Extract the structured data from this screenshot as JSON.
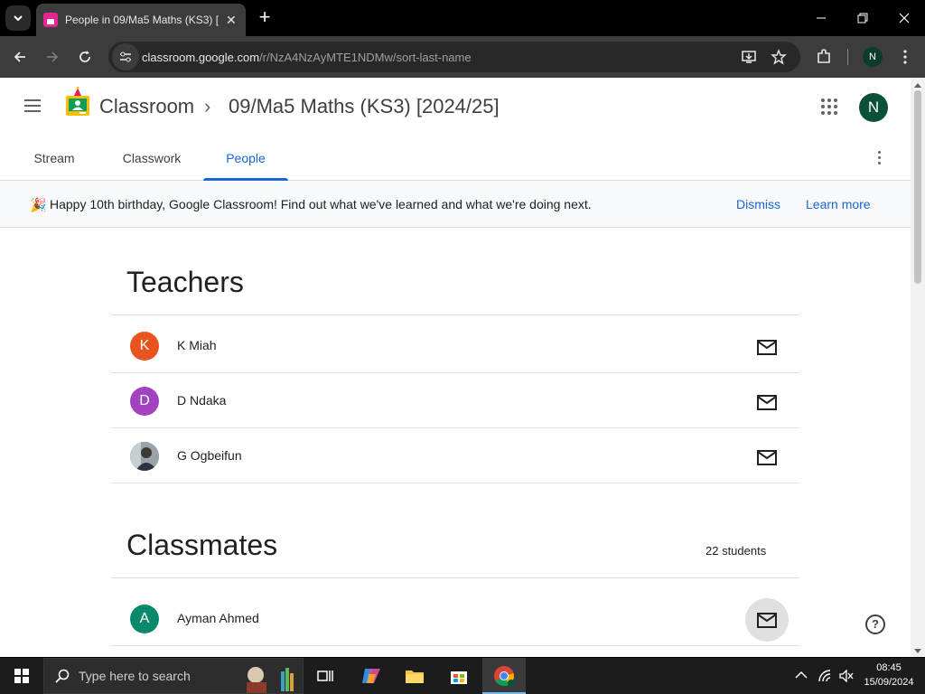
{
  "browser": {
    "tab_title": "People in 09/Ma5 Maths (KS3) [",
    "url_host": "classroom.google.com",
    "url_path": "/r/NzA4NzAyMTE1NDMw/sort-last-name",
    "profile_initial": "N"
  },
  "app": {
    "brand": "Classroom",
    "breadcrumb_sep": "›",
    "class_name": "09/Ma5 Maths (KS3) [2024/25]",
    "avatar_initial": "N"
  },
  "tabs": [
    {
      "label": "Stream"
    },
    {
      "label": "Classwork"
    },
    {
      "label": "People",
      "active": true
    }
  ],
  "banner": {
    "icon": "🎉",
    "message": "Happy 10th birthday, Google Classroom! Find out what we've learned and what we're doing next.",
    "dismiss": "Dismiss",
    "learn_more": "Learn more"
  },
  "teachers": {
    "title": "Teachers",
    "people": [
      {
        "initial": "K",
        "name": "K Miah",
        "color": "#e8541e"
      },
      {
        "initial": "D",
        "name": "D Ndaka",
        "color": "#a142c0"
      },
      {
        "initial": "",
        "name": "G Ogbeifun",
        "color": "#5f6b73"
      }
    ]
  },
  "classmates": {
    "title": "Classmates",
    "count": "22 students",
    "people": [
      {
        "initial": "A",
        "name": "Ayman Ahmed",
        "color": "#0b8a6a"
      }
    ]
  },
  "help": "?",
  "taskbar": {
    "search_placeholder": "Type here to search",
    "time": "08:45",
    "date": "15/09/2024"
  },
  "colors": {
    "accent": "#1967d2",
    "brand_green": "#0b5139"
  }
}
